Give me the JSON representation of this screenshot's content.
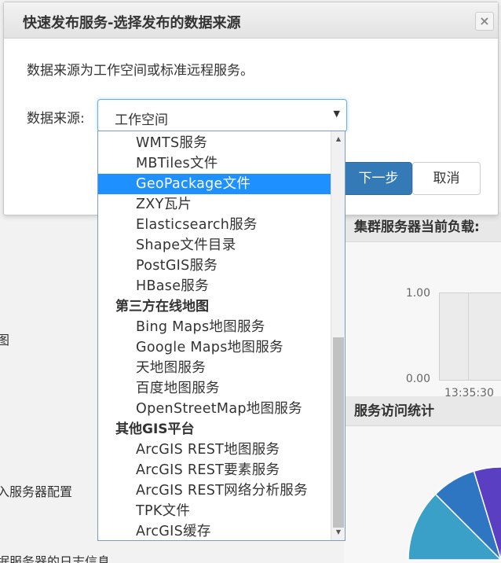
{
  "dialog": {
    "title": "快速发布服务-选择发布的数据来源",
    "close": "×",
    "description": "数据来源为工作空间或标准远程服务。",
    "field_label": "数据来源:",
    "select_value": "工作空间",
    "caret": "▼",
    "next_button": "下一步",
    "cancel_button": "取消"
  },
  "dropdown": {
    "scroll_up": "▲",
    "scroll_down": "▼",
    "items": [
      {
        "label": "WMTS服务"
      },
      {
        "label": "MBTiles文件"
      },
      {
        "label": "GeoPackage文件",
        "selected": true
      },
      {
        "label": "ZXY瓦片"
      },
      {
        "label": "Elasticsearch服务"
      },
      {
        "label": "Shape文件目录"
      },
      {
        "label": "PostGIS服务"
      },
      {
        "label": "HBase服务"
      },
      {
        "label": "第三方在线地图",
        "group": true
      },
      {
        "label": "Bing Maps地图服务"
      },
      {
        "label": "Google Maps地图服务"
      },
      {
        "label": "天地图服务"
      },
      {
        "label": "百度地图服务"
      },
      {
        "label": "OpenStreetMap地图服务"
      },
      {
        "label": "其他GIS平台",
        "group": true
      },
      {
        "label": "ArcGIS REST地图服务"
      },
      {
        "label": "ArcGIS REST要素服务"
      },
      {
        "label": "ArcGIS REST网络分析服务"
      },
      {
        "label": "TPK文件"
      },
      {
        "label": "ArcGIS缓存"
      }
    ]
  },
  "background": {
    "left_texts": [
      "图",
      "入服务器配置",
      "据服务器的日志信息"
    ],
    "cluster_panel": {
      "title": "集群服务器当前负载:",
      "y_ticks": [
        "1.00",
        "0.00"
      ],
      "x_tick": "13:35:30"
    },
    "stats_panel": {
      "title": "服务访问统计"
    }
  },
  "chart_data": {
    "type": "pie",
    "title": "服务访问统计",
    "values": [],
    "colors": [
      "#3aa0c8",
      "#2f76c2",
      "#5b3fc2",
      "#c46be0"
    ]
  }
}
